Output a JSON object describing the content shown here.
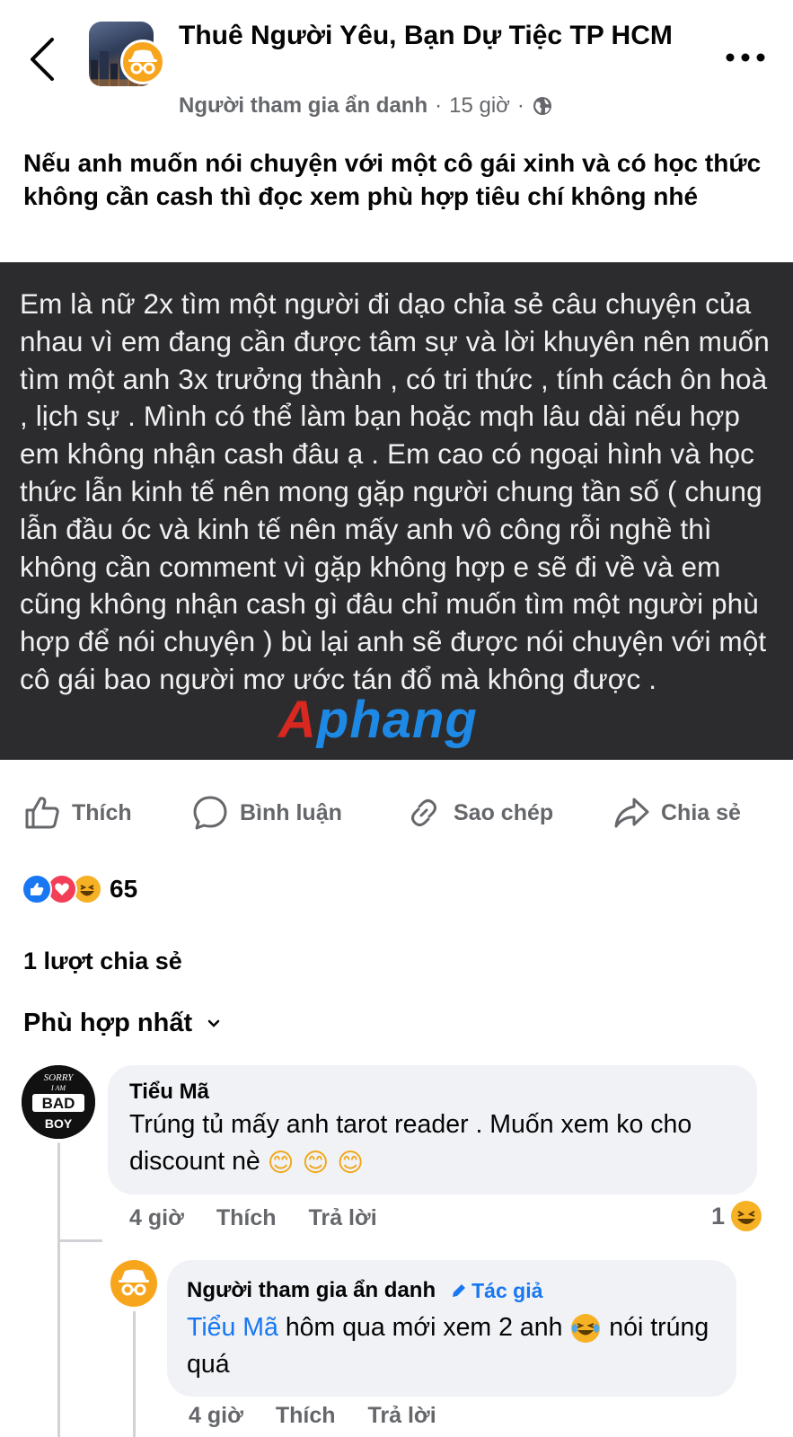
{
  "header": {
    "group_title": "Thuê Người Yêu, Bạn Dự Tiệc TP HCM",
    "poster": "Người tham gia ẩn danh",
    "dot": "·",
    "time": "15 giờ",
    "visibility_icon": "globe-icon"
  },
  "post": {
    "title": "Nếu anh muốn nói chuyện với một cô gái xinh và có học thức không cần cash thì đọc xem phù hợp tiêu chí không nhé",
    "body": "Em là nữ 2x tìm một người đi dạo chỉa sẻ câu chuyện của nhau vì em đang cần được tâm sự và lời khuyên nên muốn tìm một anh 3x trưởng thành , có tri thức , tính cách ôn hoà , lịch sự . Mình có thể làm bạn hoặc mqh lâu dài nếu hợp em không nhận cash đâu ạ . Em cao có ngoại hình và học thức lẫn kinh tế nên mong gặp người chung tần số ( chung lẫn đầu óc và kinh tế nên mấy anh vô công rỗi nghề thì không cần comment vì gặp không hợp e sẽ đi về và em cũng không nhận cash gì đâu chỉ muốn tìm một người phù hợp để nói chuyện ) bù lại anh sẽ được nói chuyện với một cô gái bao người mơ ước tán đổ mà không được .",
    "watermark_part1": "A",
    "watermark_part2": "phang"
  },
  "actions": {
    "like": "Thích",
    "comment": "Bình luận",
    "copy": "Sao chép",
    "share": "Chia sẻ"
  },
  "stats": {
    "reaction_count": "65",
    "shares": "1 lượt chia sẻ"
  },
  "sort": {
    "label": "Phù hợp nhất"
  },
  "comments": [
    {
      "name": "Tiểu Mã",
      "text": "Trúng tủ mấy anh tarot reader . Muốn xem ko cho discount nè",
      "emojis": "😊 😊 😊",
      "time": "4 giờ",
      "like": "Thích",
      "reply": "Trả lời",
      "reaction_count": "1",
      "avatar_text_top": "SORRY",
      "avatar_text_mid": "I AM",
      "avatar_text_main": "BAD",
      "avatar_text_bottom": "BOY"
    },
    {
      "name": "Người tham gia ẩn danh",
      "author_tag": "Tác giả",
      "mention": "Tiểu Mã",
      "text_a": "hôm qua mới xem 2 anh",
      "text_b": "nói trúng quá",
      "time": "4 giờ",
      "like": "Thích",
      "reply": "Trả lời"
    }
  ],
  "colors": {
    "accent": "#1877f2",
    "anon": "#f7a51c",
    "dark_block": "#2c2c2e",
    "muted": "#65676b"
  }
}
